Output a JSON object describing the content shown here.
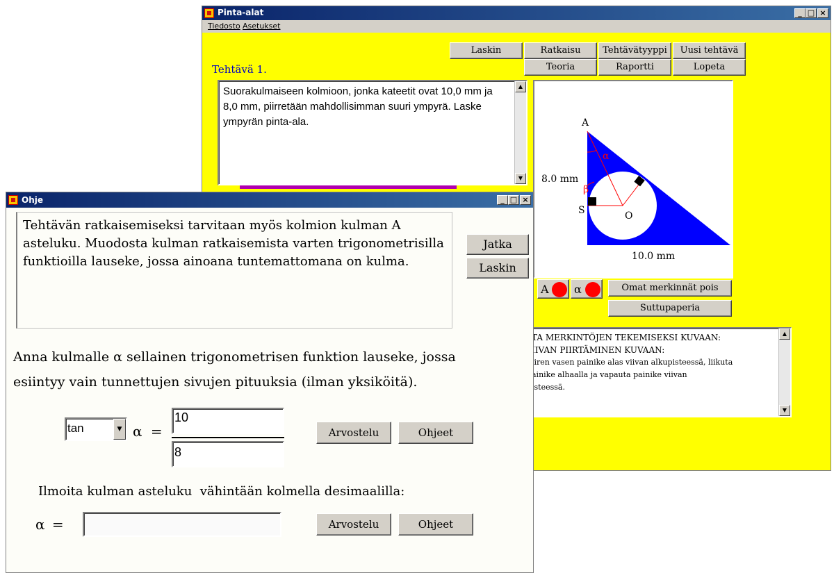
{
  "main_window": {
    "title": "Pinta-alat",
    "menu": [
      "Tiedosto",
      "Asetukset"
    ],
    "task_heading": "Tehtävä 1.",
    "buttons_row1": [
      "Laskin",
      "Ratkaisu",
      "Tehtävätyyppi",
      "Uusi tehtävä"
    ],
    "buttons_row2": [
      "Teoria",
      "Raportti",
      "Lopeta"
    ],
    "task_text": "Suorakulmaiseen kolmioon, jonka kateetit ovat 10,0 mm ja 8,0 mm, piirretään mahdollisimman suuri ympyrä. Laske ympyrän pinta-ala.",
    "figure": {
      "label_A": "A",
      "label_S": "S",
      "label_O": "O",
      "label_alpha": "α",
      "label_beta": "β",
      "side_vertical": "8.0 mm",
      "side_horizontal": "10.0 mm"
    },
    "marker_A": "A",
    "marker_alpha": "α",
    "btn_clear_marks": "Omat merkinnät pois",
    "btn_scratch": "Suttupaperia",
    "help_text_lines": [
      "TA MERKINTÖJEN TEKEMISEKSI KUVAAN:",
      "IIVAN PIIRTÄMINEN KUVAAN:",
      "iiren vasen painike alas viivan alkupisteessä, liikuta",
      "ainike alhaalla ja vapauta painike viivan",
      "isteessä."
    ],
    "colors": {
      "background": "#ffff00",
      "title_bar": "#0a246a",
      "triangle": "#0000ff",
      "marker": "#ff0000"
    }
  },
  "dialog": {
    "title": "Ohje",
    "hint_text": "Tehtävän ratkaisemiseksi tarvitaan myös kolmion kulman A asteluku. Muodosta kulman ratkaisemista varten trigonometrisilla funktioilla lauseke, jossa ainoana tuntemattomana on kulma.",
    "btn_continue": "Jatka",
    "btn_calculator": "Laskin",
    "prompt_line1": "Anna kulmalle α sellainen trigonometrisen funktion lauseke, jossa",
    "prompt_line2": "esiintyy vain tunnettujen sivujen pituuksia (ilman yksiköitä).",
    "func_select": "tan",
    "alpha_equals": "α =",
    "numerator": "10",
    "denominator": "8",
    "btn_grade": "Arvostelu",
    "btn_instructions": "Ohjeet",
    "degrees_prompt": "Ilmoita kulman asteluku  vähintään kolmella desimaalilla:",
    "alpha_label": "α =",
    "degrees_value": ""
  }
}
